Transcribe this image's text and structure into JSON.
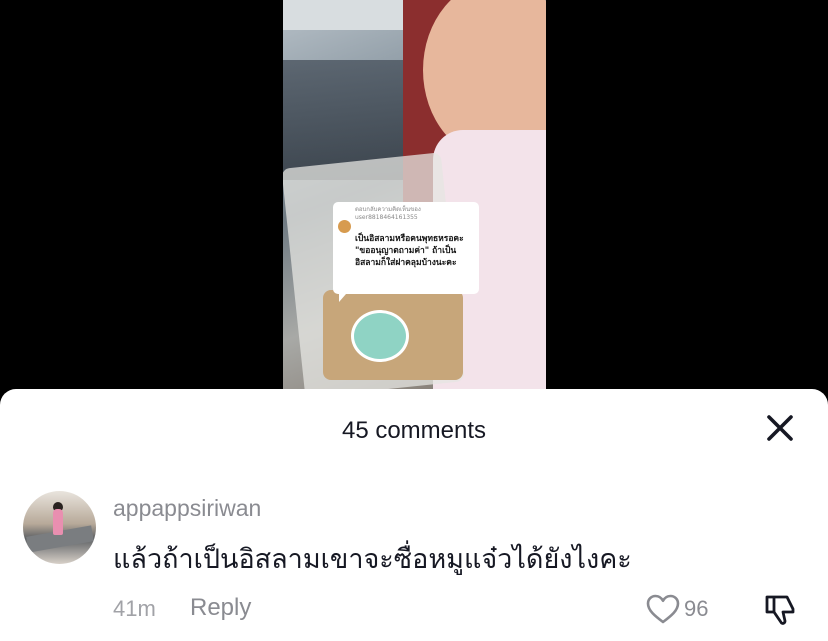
{
  "video": {
    "reply_bubble": {
      "reply_meta": "ตอบกลับความคิดเห็นของ user8818464161355",
      "reply_text": "เป็นอิสลามหรือคนพุทธหรอคะ \"ขออนุญาตถามค่า\" ถ้าเป็นอิสลามก็ใส่ฝาคลุมบ้างนะคะ"
    }
  },
  "sheet": {
    "title": "45 comments",
    "close_icon": "close-x-icon"
  },
  "comment": {
    "username": "appappsiriwan",
    "text": "แล้วถ้าเป็นอิสลามเขาจะซื่อหมูแจ๋วได้ยังไงคะ",
    "time": "41m",
    "reply_label": "Reply",
    "like_count": "96",
    "like_icon": "heart-outline-icon",
    "dislike_icon": "thumbs-down-icon"
  }
}
